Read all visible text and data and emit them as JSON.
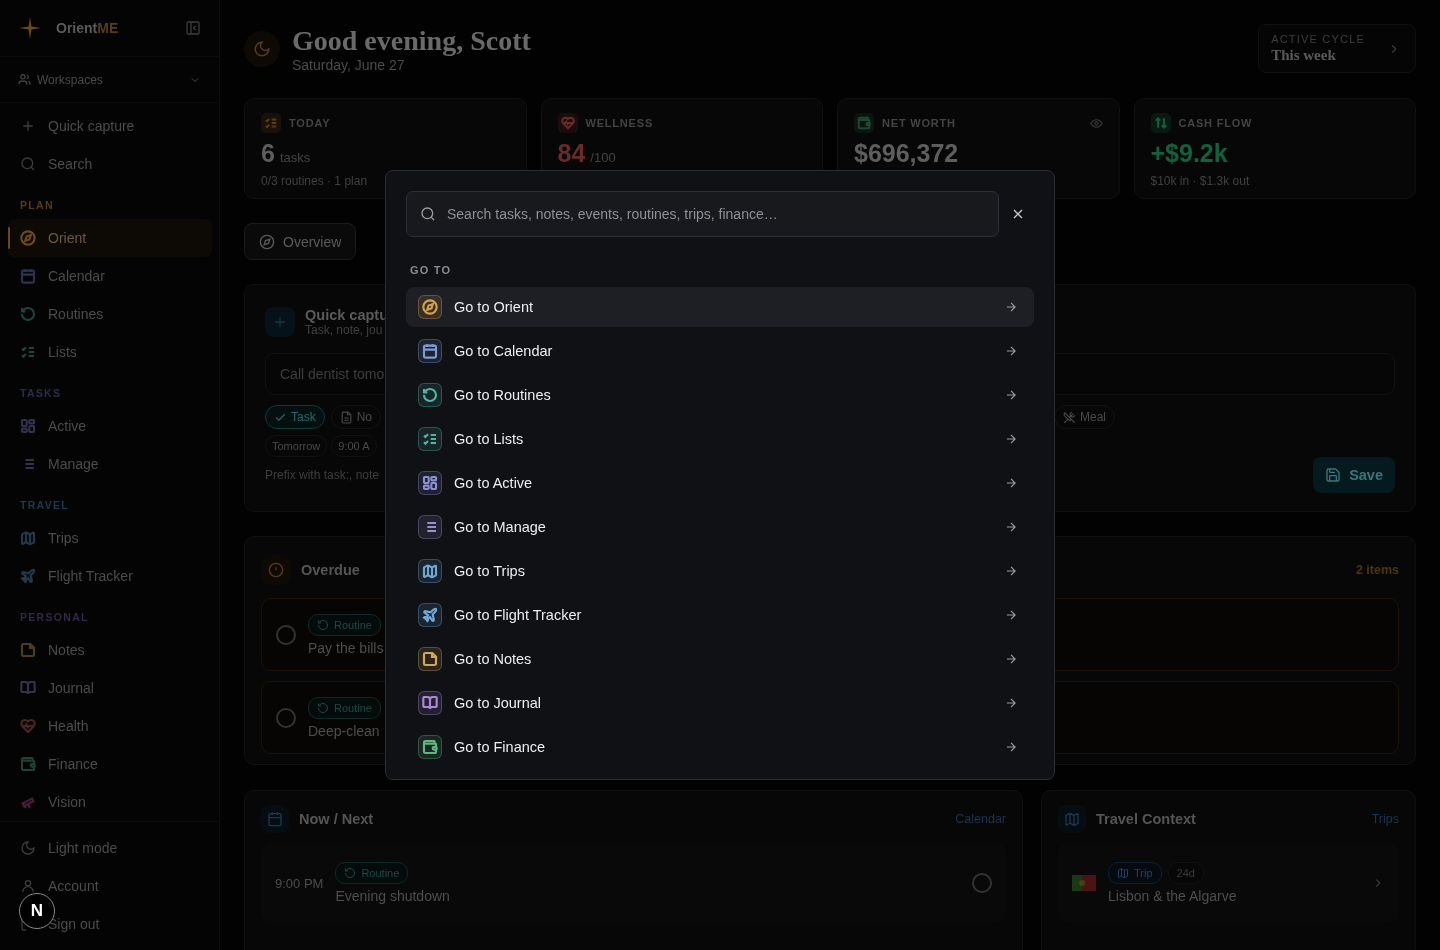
{
  "sidebar": {
    "brand": {
      "name": "Orient",
      "suffix": "ME"
    },
    "workspace": "Workspaces",
    "actions": [
      {
        "label": "Quick capture"
      },
      {
        "label": "Search"
      }
    ],
    "sections": [
      {
        "title": "PLAN",
        "color": "#5a3c14",
        "items": [
          {
            "label": "Orient",
            "color": "#6b4a16",
            "selected": true
          },
          {
            "label": "Calendar",
            "color": "#2b3552",
            "selected": false
          },
          {
            "label": "Routines",
            "color": "#1e4440",
            "selected": false
          },
          {
            "label": "Lists",
            "color": "#1e4440",
            "selected": false
          }
        ]
      },
      {
        "title": "TASKS",
        "color": "#2a2e4c",
        "items": [
          {
            "label": "Active",
            "color": "#30324e",
            "selected": false
          },
          {
            "label": "Manage",
            "color": "#30324e",
            "selected": false
          }
        ]
      },
      {
        "title": "TRAVEL",
        "color": "#1d3a4c",
        "items": [
          {
            "label": "Trips",
            "color": "#22394c",
            "selected": false
          },
          {
            "label": "Flight Tracker",
            "color": "#22394c",
            "selected": false
          }
        ]
      },
      {
        "title": "PERSONAL",
        "color": "#33284a",
        "items": [
          {
            "label": "Notes",
            "color": "#4e3d1c",
            "selected": false
          },
          {
            "label": "Journal",
            "color": "#36304c",
            "selected": false
          },
          {
            "label": "Health",
            "color": "#4c2424",
            "selected": false
          },
          {
            "label": "Finance",
            "color": "#1d4430",
            "selected": false
          },
          {
            "label": "Vision",
            "color": "#4a2036",
            "selected": false
          }
        ]
      }
    ],
    "footer": [
      {
        "label": "Light mode"
      },
      {
        "label": "Account"
      },
      {
        "label": "Sign out"
      }
    ],
    "dev_badge": "N"
  },
  "header": {
    "greeting": "Good evening, Scott",
    "date": "Saturday, June 27",
    "cycle": {
      "label": "ACTIVE CYCLE",
      "value": "This week"
    }
  },
  "stats": [
    {
      "label": "TODAY",
      "value": "6",
      "unit": "tasks",
      "sub": "0/3 routines · 1 plan",
      "color": "#5a3c14",
      "highlight": false,
      "hide_toggle": false
    },
    {
      "label": "WELLNESS",
      "value": "84",
      "unit": "/100",
      "color": "#6a2a2a",
      "highlight": true,
      "hide_toggle": false
    },
    {
      "label": "NET WORTH",
      "value": "$696,372",
      "color": "#1d4a30",
      "highlight": false,
      "hide_toggle": true
    },
    {
      "label": "CASH FLOW",
      "value": "+$9.2k",
      "sub": "$10k in · $1.3k out",
      "color": "#12603c",
      "highlight": true,
      "hide_toggle": false
    }
  ],
  "tabs": [
    {
      "label": "Overview",
      "selected": true
    }
  ],
  "quick_capture": {
    "title": "Quick captu",
    "subtitle": "Task, note, jou",
    "placeholder": "Call dentist tomo",
    "types": [
      {
        "label": "Task",
        "selected": true
      },
      {
        "label": "No",
        "selected": false
      },
      {
        "label": "Meal",
        "selected": false
      }
    ],
    "when": [
      "Tomorrow",
      "9:00 A"
    ],
    "hint": "Prefix with task:, note",
    "save": "Save"
  },
  "overdue": {
    "title": "Overdue",
    "count": "2 items",
    "items": [
      {
        "tag": "Routine",
        "title": "Pay the bills",
        "done": false
      },
      {
        "tag": "Routine",
        "title": "Deep-clean",
        "done": false
      }
    ]
  },
  "now_next": {
    "title": "Now / Next",
    "link": "Calendar",
    "items": [
      {
        "time": "9:00 PM",
        "tag": "Routine",
        "title": "Evening shutdown",
        "done": false
      }
    ]
  },
  "travel": {
    "title": "Travel Context",
    "link": "Trips",
    "items": [
      {
        "tag": "Trip",
        "countdown": "24d",
        "title": "Lisbon & the Algarve"
      }
    ]
  },
  "command_palette": {
    "placeholder": "Search tasks, notes, events, routines, trips, finance…",
    "section": "GO TO",
    "items": [
      {
        "label": "Go to Orient",
        "color": "#d9a04a",
        "selected": true
      },
      {
        "label": "Go to Calendar",
        "color": "#7d9bd6",
        "selected": false
      },
      {
        "label": "Go to Routines",
        "color": "#4fb3a6",
        "selected": false
      },
      {
        "label": "Go to Lists",
        "color": "#4fb3a6",
        "selected": false
      },
      {
        "label": "Go to Active",
        "color": "#8b8fd6",
        "selected": false
      },
      {
        "label": "Go to Manage",
        "color": "#9a8fd0",
        "selected": false
      },
      {
        "label": "Go to Trips",
        "color": "#6fa7d6",
        "selected": false
      },
      {
        "label": "Go to Flight Tracker",
        "color": "#6fa7d6",
        "selected": false
      },
      {
        "label": "Go to Notes",
        "color": "#d4a856",
        "selected": false
      },
      {
        "label": "Go to Journal",
        "color": "#a98ad6",
        "selected": false
      },
      {
        "label": "Go to Finance",
        "color": "#5fb87d",
        "selected": false
      }
    ]
  }
}
